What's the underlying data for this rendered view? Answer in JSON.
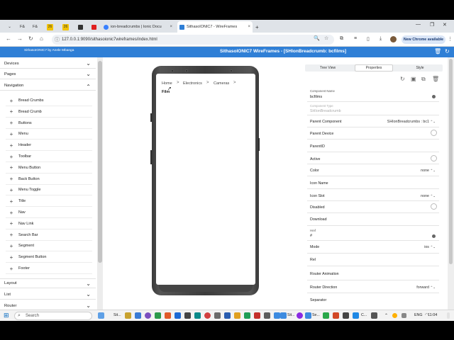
{
  "browser": {
    "tabs": [
      {
        "label": "F&",
        "color": "#3b7ddd"
      },
      {
        "label": "F&",
        "color": "#3b7ddd"
      },
      {
        "label": "26",
        "color": "#f2c200"
      },
      {
        "label": "26",
        "color": "#f2c200"
      },
      {
        "label": "",
        "color": "#333333"
      },
      {
        "label": "",
        "color": "#e02020"
      },
      {
        "label": "ion-breadcrumbs | Ionic Docu",
        "color": "#3880ff"
      },
      {
        "label": "SithasolONIC7 - WireFrames",
        "color": "#2f7fd6"
      }
    ],
    "close_glyph": "×",
    "new_tab": "+",
    "url": "127.0.0.1:9090/sithasoionic7wireframes/index.html",
    "chrome_badge": "New Chrome available"
  },
  "app": {
    "subtitle": "SithasoIONIC7 by Anele Mbanga",
    "title": "SithasoIONIC7 WireFrames - [SHIonBreadcrumb: bcfilms]"
  },
  "sidebar": {
    "sections_top": [
      {
        "label": "Devices",
        "chevron": "⌄"
      },
      {
        "label": "Pages",
        "chevron": "⌄"
      },
      {
        "label": "Navigation",
        "chevron": "⌃"
      }
    ],
    "items": [
      "Bread Crumbs",
      "Bread Crumb",
      "Buttons",
      "Menu",
      "Header",
      "Toolbar",
      "Menu Button",
      "Back Button",
      "Menu Toggle",
      "Title",
      "Nav",
      "Nav Link",
      "Search Bar",
      "Segment",
      "Segment Button",
      "Footer"
    ],
    "sections_bottom": [
      {
        "label": "Layout",
        "chevron": "⌄"
      },
      {
        "label": "List",
        "chevron": "⌄"
      },
      {
        "label": "Router",
        "chevron": "⌄"
      }
    ]
  },
  "preview": {
    "breadcrumbs": [
      "Home",
      "Electronics",
      "Cameras"
    ],
    "separator": ">",
    "current": "Film"
  },
  "properties": {
    "tabs": [
      "Tree View",
      "Properties",
      "Style"
    ],
    "active_tab": "Properties",
    "component_name_label": "Component Name",
    "component_name_value": "bcfilms",
    "component_type_label": "Component Type",
    "component_type_value": "SHIonBreadcrumb",
    "parent_component_label": "Parent Component",
    "parent_component_value": "SHIonBreadcrumbs : bc1",
    "parent_device_label": "Parent Device",
    "parentid_label": "ParentID",
    "active_label": "Active",
    "color_label": "Color",
    "color_value": "none",
    "icon_name_label": "Icon Name",
    "icon_slot_label": "Icon Slot",
    "icon_slot_value": "none",
    "disabled_label": "Disabled",
    "download_label": "Download",
    "href_label": "Href",
    "href_value": "#",
    "mode_label": "Mode",
    "mode_value": "ios",
    "rel_label": "Rel",
    "router_animation_label": "Router Animation",
    "router_direction_label": "Router Direction",
    "router_direction_value": "forward",
    "separator_label": "Separator",
    "stepper_glyph": "⌃⌄"
  },
  "taskbar": {
    "search_placeholder": "Search",
    "app1": "Sit...",
    "app2": "Sit...",
    "app3": "Se...",
    "app4": "C...",
    "lang": "ENG",
    "time": "11:04"
  },
  "icons": {
    "back": "←",
    "forward": "→",
    "reload": "↻",
    "home": "⌂",
    "zoom": "🔍",
    "star": "☆",
    "extensions": "⧉",
    "menu": "⋮",
    "trash": "🗑",
    "refresh": "↻",
    "windows": "⊞"
  }
}
